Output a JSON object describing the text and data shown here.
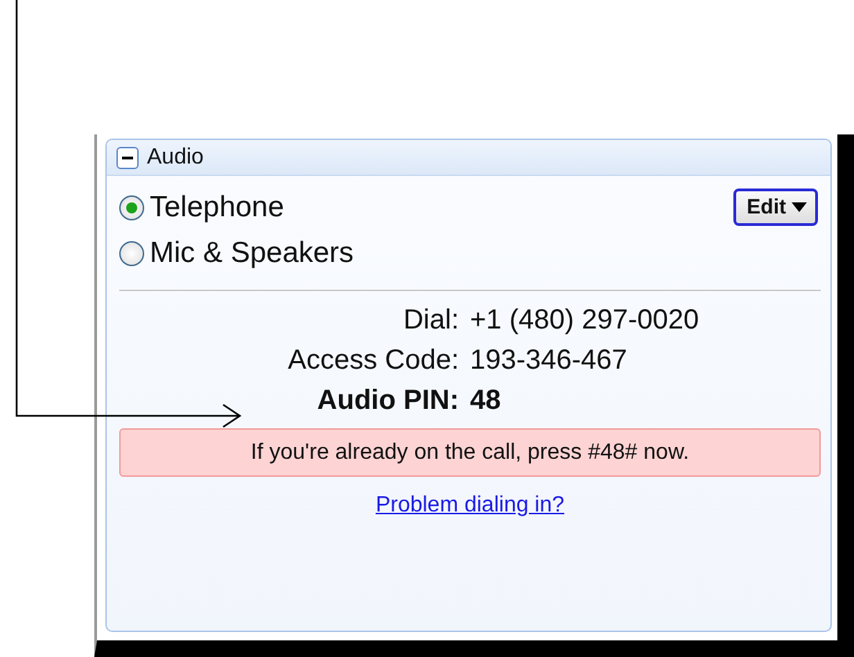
{
  "panel": {
    "title": "Audio",
    "expanded": true
  },
  "options": [
    {
      "label": "Telephone",
      "selected": true
    },
    {
      "label": "Mic & Speakers",
      "selected": false
    }
  ],
  "edit_button": {
    "label": "Edit"
  },
  "details": [
    {
      "label": "Dial:",
      "value": "+1 (480) 297-0020",
      "kind": "plain"
    },
    {
      "label": "Access Code:",
      "value": "193-346-467",
      "kind": "plain"
    },
    {
      "label": "Audio PIN:",
      "value": "48",
      "kind": "emphasis"
    }
  ],
  "notice": "If you're already on the call, press #48# now.",
  "link": "Problem dialing in?"
}
